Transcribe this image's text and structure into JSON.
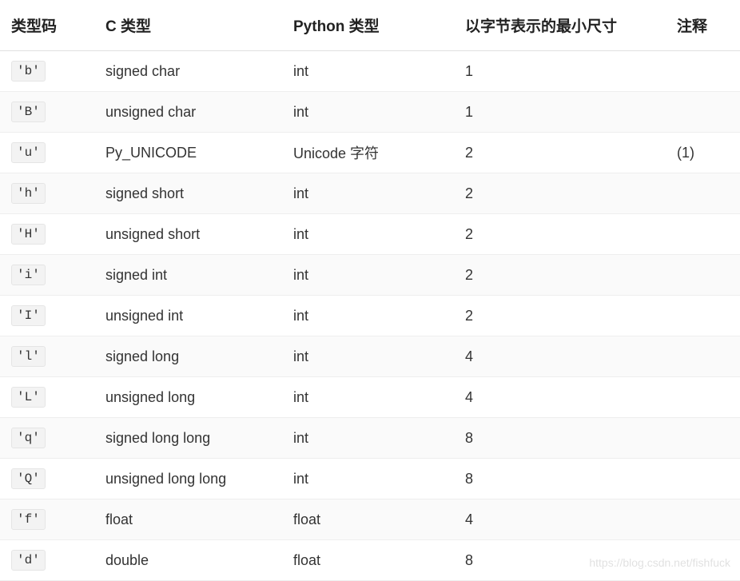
{
  "headers": {
    "typecode": "类型码",
    "ctype": "C 类型",
    "pytype": "Python 类型",
    "minsize": "以字节表示的最小尺寸",
    "note": "注释"
  },
  "rows": [
    {
      "typecode": "'b'",
      "ctype": "signed char",
      "pytype": "int",
      "minsize": "1",
      "note": ""
    },
    {
      "typecode": "'B'",
      "ctype": "unsigned char",
      "pytype": "int",
      "minsize": "1",
      "note": ""
    },
    {
      "typecode": "'u'",
      "ctype": "Py_UNICODE",
      "pytype": "Unicode 字符",
      "minsize": "2",
      "note": "(1)"
    },
    {
      "typecode": "'h'",
      "ctype": "signed short",
      "pytype": "int",
      "minsize": "2",
      "note": ""
    },
    {
      "typecode": "'H'",
      "ctype": "unsigned short",
      "pytype": "int",
      "minsize": "2",
      "note": ""
    },
    {
      "typecode": "'i'",
      "ctype": "signed int",
      "pytype": "int",
      "minsize": "2",
      "note": ""
    },
    {
      "typecode": "'I'",
      "ctype": "unsigned int",
      "pytype": "int",
      "minsize": "2",
      "note": ""
    },
    {
      "typecode": "'l'",
      "ctype": "signed long",
      "pytype": "int",
      "minsize": "4",
      "note": ""
    },
    {
      "typecode": "'L'",
      "ctype": "unsigned long",
      "pytype": "int",
      "minsize": "4",
      "note": ""
    },
    {
      "typecode": "'q'",
      "ctype": "signed long long",
      "pytype": "int",
      "minsize": "8",
      "note": ""
    },
    {
      "typecode": "'Q'",
      "ctype": "unsigned long long",
      "pytype": "int",
      "minsize": "8",
      "note": ""
    },
    {
      "typecode": "'f'",
      "ctype": "float",
      "pytype": "float",
      "minsize": "4",
      "note": ""
    },
    {
      "typecode": "'d'",
      "ctype": "double",
      "pytype": "float",
      "minsize": "8",
      "note": ""
    }
  ],
  "watermark": "https://blog.csdn.net/fishfuck"
}
